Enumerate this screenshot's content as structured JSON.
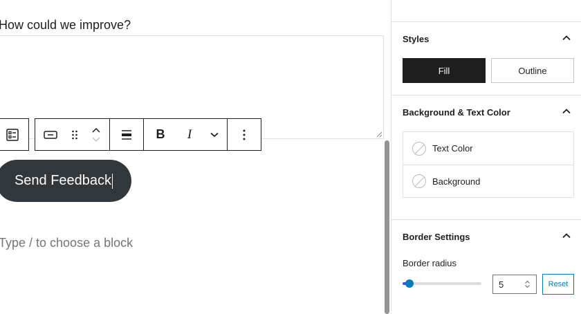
{
  "editor": {
    "question_label": "How could we improve?",
    "button_text": "Send Feedback",
    "placeholder": "Type / to choose a block"
  },
  "toolbar": {
    "icons": [
      "form-block-icon",
      "button-block-icon",
      "drag-handle-icon",
      "move-up-icon",
      "move-down-icon",
      "align-icon",
      "bold-icon",
      "italic-icon",
      "more-formats-chevron-icon",
      "options-icon"
    ]
  },
  "sidebar": {
    "styles": {
      "title": "Styles",
      "fill_label": "Fill",
      "outline_label": "Outline",
      "selected": "Fill"
    },
    "colors": {
      "title": "Background & Text Color",
      "text_color_label": "Text Color",
      "background_label": "Background"
    },
    "border": {
      "title": "Border Settings",
      "radius_label": "Border radius",
      "radius_value": "5",
      "slider_fraction": 0.09,
      "reset_label": "Reset"
    }
  },
  "colors": {
    "button_bg": "#32373c",
    "accent": "#007cba",
    "fill_active": "#1e1e1e"
  }
}
